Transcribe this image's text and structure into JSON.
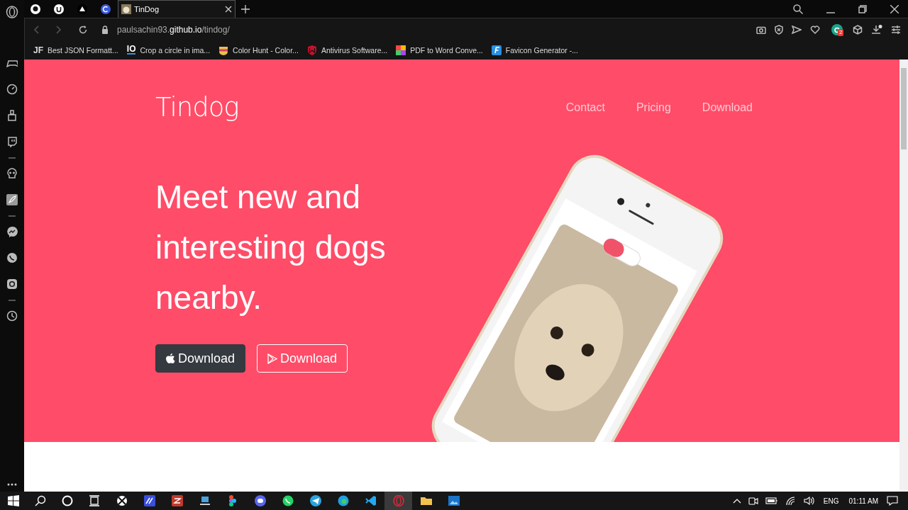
{
  "browser": {
    "tabs": [
      {
        "kind": "pinned",
        "selected": false
      },
      {
        "kind": "pinned",
        "selected": false
      },
      {
        "kind": "pinned",
        "selected": false
      },
      {
        "kind": "pinned",
        "selected": false
      },
      {
        "kind": "page",
        "label": "TinDog",
        "selected": true
      }
    ],
    "url_host": "paulsachin93.",
    "url_domain": "github.io",
    "url_path": "/tindog/",
    "bookmarks": [
      {
        "badge": "JF",
        "label": "Best JSON Formatt..."
      },
      {
        "badge": "IO",
        "label": "Crop a circle in ima..."
      },
      {
        "label": "Color Hunt - Color..."
      },
      {
        "label": "Antivirus Software..."
      },
      {
        "label": "PDF to Word Conve..."
      },
      {
        "label": "Favicon Generator -..."
      }
    ],
    "extension_badge": "2"
  },
  "page": {
    "brand": "Tindog",
    "nav": [
      "Contact",
      "Pricing",
      "Download"
    ],
    "heading": "Meet new and interesting dogs nearby.",
    "buttons": [
      {
        "kind": "apple",
        "label": "Download"
      },
      {
        "kind": "play",
        "label": "Download"
      }
    ]
  },
  "taskbar": {
    "apps": [
      {
        "selected": false
      },
      {
        "selected": false
      },
      {
        "selected": false
      },
      {
        "selected": false
      },
      {
        "selected": false
      },
      {
        "selected": false
      },
      {
        "selected": false
      },
      {
        "selected": false
      },
      {
        "selected": false
      },
      {
        "selected": false
      },
      {
        "selected": true
      },
      {
        "selected": false
      },
      {
        "selected": false
      }
    ],
    "language": "ENG",
    "time": "01:11 AM"
  }
}
